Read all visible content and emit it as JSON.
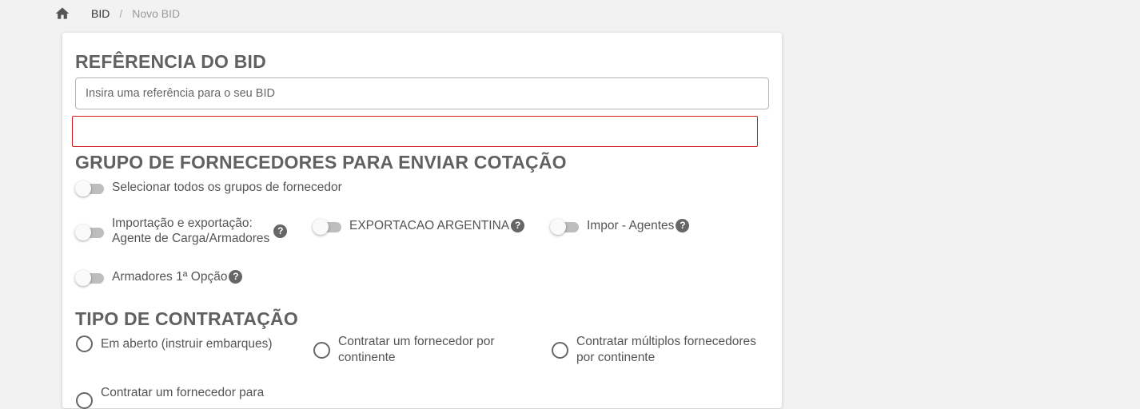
{
  "breadcrumb": {
    "home_icon": "home-icon",
    "link_label": "BID",
    "separator": "/",
    "current_label": "Novo BID"
  },
  "reference": {
    "title": "REFÊRENCIA DO BID",
    "placeholder": "Insira uma referência para o seu BID",
    "value": ""
  },
  "groups": {
    "title": "GRUPO DE FORNECEDORES PARA ENVIAR COTAÇÃO",
    "select_all_label": "Selecionar todos os grupos de fornecedor",
    "items": [
      {
        "label_line1": "Importação e exportação:",
        "label_line2": "Agente de Carga/Armadores",
        "checked": false
      },
      {
        "label": "EXPORTACAO ARGENTINA",
        "checked": false
      },
      {
        "label": "Impor - Agentes",
        "checked": false
      },
      {
        "label": "Armadores 1ª Opção",
        "checked": false
      }
    ],
    "help_glyph": "?"
  },
  "contract": {
    "title": "TIPO DE CONTRATAÇÃO",
    "options": [
      {
        "label": "Em aberto (instruir embarques)",
        "selected": false
      },
      {
        "label_line1": "Contratar um fornecedor por",
        "label_line2": "continente",
        "selected": false
      },
      {
        "label_line1": "Contratar múltiplos fornecedores",
        "label_line2": "por continente",
        "selected": false
      },
      {
        "label": "Contratar um fornecedor para",
        "selected": false
      }
    ]
  },
  "colors": {
    "error_border": "#d11a1a",
    "title_text": "#616161",
    "toggle_track_off": "#bdbdbd"
  }
}
